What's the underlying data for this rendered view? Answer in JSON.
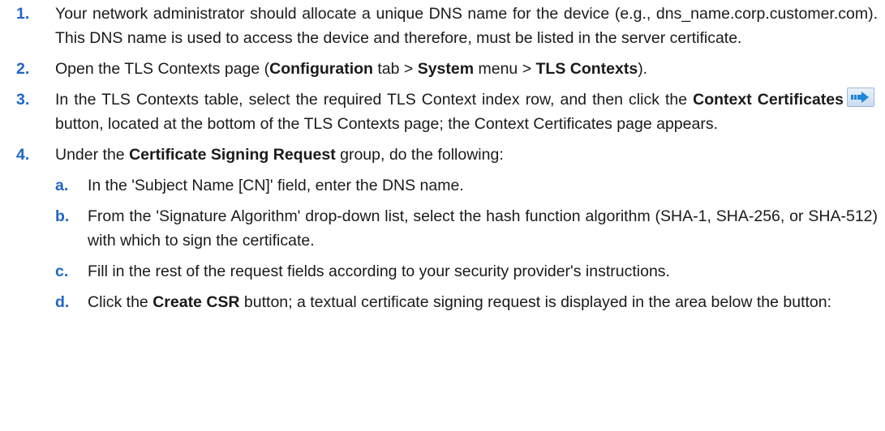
{
  "colors": {
    "step_number": "#1f66c7",
    "text": "#1a1a1a",
    "icon_arrow": "#1e86d9"
  },
  "steps": [
    {
      "number": "1.",
      "text": "Your network administrator should allocate a unique DNS name for the device (e.g., dns_name.corp.customer.com). This DNS name is used to access the device and therefore, must be listed in the server certificate."
    },
    {
      "number": "2.",
      "t1": "Open the TLS Contexts page (",
      "b1": "Configuration",
      "t2": " tab > ",
      "b2": "System",
      "t3": " menu > ",
      "b3": "TLS Contexts",
      "t4": ")."
    },
    {
      "number": "3.",
      "t1": "In the TLS Contexts table, select the required TLS Context index row, and then click the ",
      "b1": "Context Certificates",
      "icon": "context-certificates-arrow-icon",
      "t2": " button, located at the bottom of the TLS Contexts page; the Context Certificates page appears."
    },
    {
      "number": "4.",
      "t1": "Under the ",
      "b1": "Certificate Signing Request",
      "t2": " group, do the following:",
      "substeps": [
        {
          "letter": "a.",
          "text": "In the 'Subject Name [CN]' field, enter the DNS name."
        },
        {
          "letter": "b.",
          "text": "From the 'Signature Algorithm' drop-down list, select the hash function algorithm (SHA-1, SHA-256, or SHA-512) with which to sign the certificate."
        },
        {
          "letter": "c.",
          "text": "Fill in the rest of the request fields according to your security provider's instructions."
        },
        {
          "letter": "d.",
          "t1": "Click the ",
          "b1": "Create CSR",
          "t2": " button; a textual certificate signing request is displayed in the area below the button:"
        }
      ]
    }
  ]
}
